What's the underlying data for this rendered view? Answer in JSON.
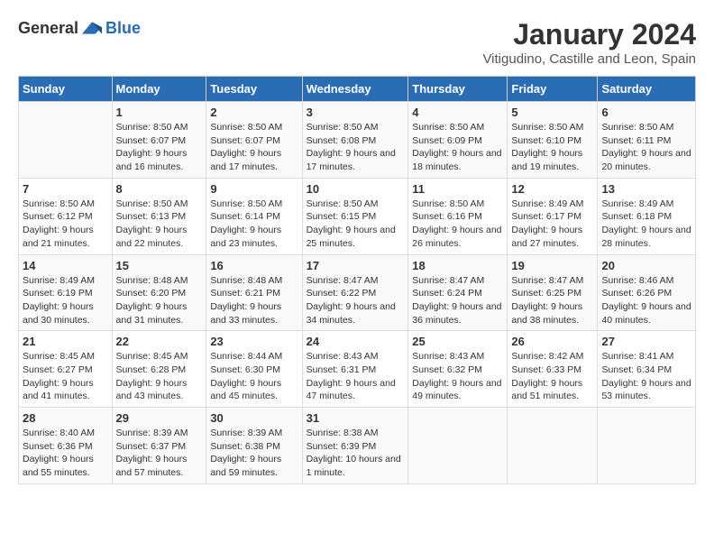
{
  "logo": {
    "general": "General",
    "blue": "Blue"
  },
  "title": "January 2024",
  "subtitle": "Vitigudino, Castille and Leon, Spain",
  "headers": [
    "Sunday",
    "Monday",
    "Tuesday",
    "Wednesday",
    "Thursday",
    "Friday",
    "Saturday"
  ],
  "weeks": [
    [
      {
        "day": "",
        "sunrise": "",
        "sunset": "",
        "daylight": ""
      },
      {
        "day": "1",
        "sunrise": "Sunrise: 8:50 AM",
        "sunset": "Sunset: 6:07 PM",
        "daylight": "Daylight: 9 hours and 16 minutes."
      },
      {
        "day": "2",
        "sunrise": "Sunrise: 8:50 AM",
        "sunset": "Sunset: 6:07 PM",
        "daylight": "Daylight: 9 hours and 17 minutes."
      },
      {
        "day": "3",
        "sunrise": "Sunrise: 8:50 AM",
        "sunset": "Sunset: 6:08 PM",
        "daylight": "Daylight: 9 hours and 17 minutes."
      },
      {
        "day": "4",
        "sunrise": "Sunrise: 8:50 AM",
        "sunset": "Sunset: 6:09 PM",
        "daylight": "Daylight: 9 hours and 18 minutes."
      },
      {
        "day": "5",
        "sunrise": "Sunrise: 8:50 AM",
        "sunset": "Sunset: 6:10 PM",
        "daylight": "Daylight: 9 hours and 19 minutes."
      },
      {
        "day": "6",
        "sunrise": "Sunrise: 8:50 AM",
        "sunset": "Sunset: 6:11 PM",
        "daylight": "Daylight: 9 hours and 20 minutes."
      }
    ],
    [
      {
        "day": "7",
        "sunrise": "Sunrise: 8:50 AM",
        "sunset": "Sunset: 6:12 PM",
        "daylight": "Daylight: 9 hours and 21 minutes."
      },
      {
        "day": "8",
        "sunrise": "Sunrise: 8:50 AM",
        "sunset": "Sunset: 6:13 PM",
        "daylight": "Daylight: 9 hours and 22 minutes."
      },
      {
        "day": "9",
        "sunrise": "Sunrise: 8:50 AM",
        "sunset": "Sunset: 6:14 PM",
        "daylight": "Daylight: 9 hours and 23 minutes."
      },
      {
        "day": "10",
        "sunrise": "Sunrise: 8:50 AM",
        "sunset": "Sunset: 6:15 PM",
        "daylight": "Daylight: 9 hours and 25 minutes."
      },
      {
        "day": "11",
        "sunrise": "Sunrise: 8:50 AM",
        "sunset": "Sunset: 6:16 PM",
        "daylight": "Daylight: 9 hours and 26 minutes."
      },
      {
        "day": "12",
        "sunrise": "Sunrise: 8:49 AM",
        "sunset": "Sunset: 6:17 PM",
        "daylight": "Daylight: 9 hours and 27 minutes."
      },
      {
        "day": "13",
        "sunrise": "Sunrise: 8:49 AM",
        "sunset": "Sunset: 6:18 PM",
        "daylight": "Daylight: 9 hours and 28 minutes."
      }
    ],
    [
      {
        "day": "14",
        "sunrise": "Sunrise: 8:49 AM",
        "sunset": "Sunset: 6:19 PM",
        "daylight": "Daylight: 9 hours and 30 minutes."
      },
      {
        "day": "15",
        "sunrise": "Sunrise: 8:48 AM",
        "sunset": "Sunset: 6:20 PM",
        "daylight": "Daylight: 9 hours and 31 minutes."
      },
      {
        "day": "16",
        "sunrise": "Sunrise: 8:48 AM",
        "sunset": "Sunset: 6:21 PM",
        "daylight": "Daylight: 9 hours and 33 minutes."
      },
      {
        "day": "17",
        "sunrise": "Sunrise: 8:47 AM",
        "sunset": "Sunset: 6:22 PM",
        "daylight": "Daylight: 9 hours and 34 minutes."
      },
      {
        "day": "18",
        "sunrise": "Sunrise: 8:47 AM",
        "sunset": "Sunset: 6:24 PM",
        "daylight": "Daylight: 9 hours and 36 minutes."
      },
      {
        "day": "19",
        "sunrise": "Sunrise: 8:47 AM",
        "sunset": "Sunset: 6:25 PM",
        "daylight": "Daylight: 9 hours and 38 minutes."
      },
      {
        "day": "20",
        "sunrise": "Sunrise: 8:46 AM",
        "sunset": "Sunset: 6:26 PM",
        "daylight": "Daylight: 9 hours and 40 minutes."
      }
    ],
    [
      {
        "day": "21",
        "sunrise": "Sunrise: 8:45 AM",
        "sunset": "Sunset: 6:27 PM",
        "daylight": "Daylight: 9 hours and 41 minutes."
      },
      {
        "day": "22",
        "sunrise": "Sunrise: 8:45 AM",
        "sunset": "Sunset: 6:28 PM",
        "daylight": "Daylight: 9 hours and 43 minutes."
      },
      {
        "day": "23",
        "sunrise": "Sunrise: 8:44 AM",
        "sunset": "Sunset: 6:30 PM",
        "daylight": "Daylight: 9 hours and 45 minutes."
      },
      {
        "day": "24",
        "sunrise": "Sunrise: 8:43 AM",
        "sunset": "Sunset: 6:31 PM",
        "daylight": "Daylight: 9 hours and 47 minutes."
      },
      {
        "day": "25",
        "sunrise": "Sunrise: 8:43 AM",
        "sunset": "Sunset: 6:32 PM",
        "daylight": "Daylight: 9 hours and 49 minutes."
      },
      {
        "day": "26",
        "sunrise": "Sunrise: 8:42 AM",
        "sunset": "Sunset: 6:33 PM",
        "daylight": "Daylight: 9 hours and 51 minutes."
      },
      {
        "day": "27",
        "sunrise": "Sunrise: 8:41 AM",
        "sunset": "Sunset: 6:34 PM",
        "daylight": "Daylight: 9 hours and 53 minutes."
      }
    ],
    [
      {
        "day": "28",
        "sunrise": "Sunrise: 8:40 AM",
        "sunset": "Sunset: 6:36 PM",
        "daylight": "Daylight: 9 hours and 55 minutes."
      },
      {
        "day": "29",
        "sunrise": "Sunrise: 8:39 AM",
        "sunset": "Sunset: 6:37 PM",
        "daylight": "Daylight: 9 hours and 57 minutes."
      },
      {
        "day": "30",
        "sunrise": "Sunrise: 8:39 AM",
        "sunset": "Sunset: 6:38 PM",
        "daylight": "Daylight: 9 hours and 59 minutes."
      },
      {
        "day": "31",
        "sunrise": "Sunrise: 8:38 AM",
        "sunset": "Sunset: 6:39 PM",
        "daylight": "Daylight: 10 hours and 1 minute."
      },
      {
        "day": "",
        "sunrise": "",
        "sunset": "",
        "daylight": ""
      },
      {
        "day": "",
        "sunrise": "",
        "sunset": "",
        "daylight": ""
      },
      {
        "day": "",
        "sunrise": "",
        "sunset": "",
        "daylight": ""
      }
    ]
  ]
}
